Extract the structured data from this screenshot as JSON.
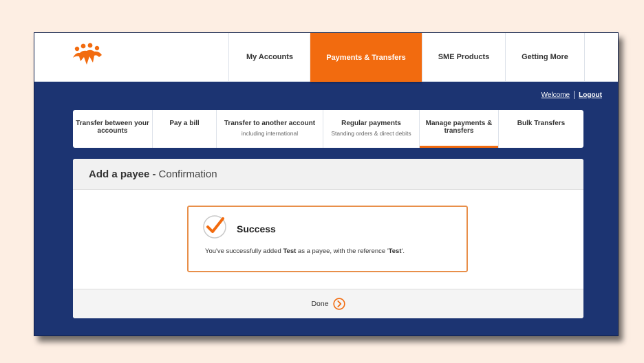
{
  "header": {
    "logo_icon": "people-logo-icon",
    "brand_color": "#f26b0f",
    "nav": [
      {
        "label": "My Accounts",
        "active": false
      },
      {
        "label": "Payments & Transfers",
        "active": true
      },
      {
        "label": "SME Products",
        "active": false
      },
      {
        "label": "Getting More",
        "active": false
      }
    ]
  },
  "user_links": {
    "welcome": "Welcome",
    "logout": "Logout"
  },
  "subnav": [
    {
      "title": "Transfer between your accounts",
      "subtitle": "",
      "active": false
    },
    {
      "title": "Pay a bill",
      "subtitle": "",
      "active": false
    },
    {
      "title": "Transfer to another account",
      "subtitle": "including international",
      "active": false
    },
    {
      "title": "Regular payments",
      "subtitle": "Standing orders & direct debits",
      "active": false
    },
    {
      "title": "Manage payments & transfers",
      "subtitle": "",
      "active": true
    },
    {
      "title": "Bulk Transfers",
      "subtitle": "",
      "active": false
    }
  ],
  "panel": {
    "title_bold": "Add a payee -",
    "title_rest": "Confirmation",
    "success": {
      "icon": "checkmark-circle-icon",
      "title": "Success",
      "msg_prefix": "You've successfully added ",
      "payee": "Test",
      "msg_middle": " as a payee, with the reference '",
      "reference": "Test",
      "msg_suffix": "'."
    },
    "done_label": "Done",
    "done_icon": "chevron-right-circle-icon"
  },
  "colors": {
    "accent": "#f26b0f",
    "navy": "#1c3472",
    "page_bg": "#fdeee3"
  }
}
